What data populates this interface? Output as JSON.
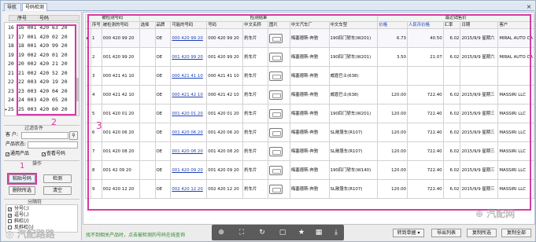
{
  "tabs": [
    {
      "label": "导航"
    },
    {
      "label": "号码检测"
    }
  ],
  "left_panel": {
    "list_headers": {
      "seq": "序号",
      "code": "号码"
    },
    "rows": [
      {
        "n": "16",
        "code": "16 001 420 63 20"
      },
      {
        "n": "17",
        "code": "17 001 420 02 20"
      },
      {
        "n": "18",
        "code": "18 001 420 99 20"
      },
      {
        "n": "19",
        "code": "19 002 420 01 20"
      },
      {
        "n": "20",
        "code": "20 002 420 21 20"
      },
      {
        "n": "21",
        "code": "21 002 420 52 20"
      },
      {
        "n": "22",
        "code": "22 003 420 19 20"
      },
      {
        "n": "23",
        "code": "23 003 420 04 20"
      },
      {
        "n": "24",
        "code": "24 003 420 05 20"
      },
      {
        "n": "25",
        "code": "25 003 420 60 20"
      }
    ],
    "current_marker": "▸",
    "annotation_2": "2",
    "filter_title": "过滤条件",
    "filter_label_1": "客 户:",
    "filter_label_2": "产品状态:",
    "check_general": "通用产品",
    "check_query": "查看号码",
    "ops_title": "操作",
    "annotation_1": "1",
    "btn_paste": "粘贴号码",
    "btn_detect": "检测",
    "btn_delete": "删除所选",
    "btn_clear": "清空",
    "cat_title": "分隔符",
    "cats": [
      {
        "checked": true,
        "label": "分号(;)"
      },
      {
        "checked": true,
        "label": "逗号(,)"
      },
      {
        "checked": false,
        "label": "斜杠(/)"
      },
      {
        "checked": false,
        "label": "反斜杠(\\)"
      }
    ]
  },
  "table": {
    "group_headers": {
      "detect": "被检测号码",
      "result": "检测结果",
      "recent": "最近销售价"
    },
    "columns": [
      "序号",
      "被检测的号码",
      "选择",
      "品牌",
      "可能的号码",
      "号码",
      "中文名称",
      "图片",
      "中文汽车厂",
      "中文车型",
      "价格",
      "人民币价格",
      "汇率",
      "日期",
      "客户"
    ],
    "annotation_3": "3",
    "rows": [
      {
        "arrow": "▸",
        "seq": "1",
        "code": "000 420 99 20",
        "brand": "OE",
        "possible": "000 420 99 20",
        "number": "000 420 99 20",
        "name": "刹车片",
        "maker": "梅塞德斯-奔驰",
        "model": "190四门轿车(W201)",
        "price": "6.73",
        "rmb": "40.50",
        "rate": "6.02",
        "date": "2015/9/9 星期六",
        "customer": "MIRAL AUTO CA",
        "has_img": true
      },
      {
        "arrow": "",
        "seq": "2",
        "code": "001 420 99 20",
        "brand": "OE",
        "possible": "001 420 99 20",
        "number": "001 420 99 20",
        "name": "刹车片",
        "maker": "梅塞德斯-奔驰",
        "model": "190四门轿车(W201)",
        "price": "3.50",
        "rmb": "21.07",
        "rate": "6.02",
        "date": "2015/9/9 星期六",
        "customer": "MIRAL AUTO CA",
        "has_img": true
      },
      {
        "arrow": "",
        "seq": "3",
        "code": "000 421 41 10",
        "brand": "OE",
        "possible": "000 421 41 10",
        "number": "000 421 41 10",
        "name": "刹车片",
        "maker": "梅塞德斯-奔驰",
        "model": "威霆巴士(638)",
        "price": "",
        "rmb": "",
        "rate": "",
        "date": "",
        "customer": "",
        "has_img": true
      },
      {
        "arrow": "",
        "seq": "4",
        "code": "000 421 42 10",
        "brand": "OE",
        "possible": "000 421 42 10",
        "number": "000 421 42 10",
        "name": "刹车片",
        "maker": "梅塞德斯-奔驰",
        "model": "威霆巴士(638)",
        "price": "120.00",
        "rmb": "722.40",
        "rate": "6.02",
        "date": "2015/9/9 星期三",
        "customer": "MASSIRI LLC",
        "has_img": true
      },
      {
        "arrow": "",
        "seq": "5",
        "code": "001 420 01 20",
        "brand": "OE",
        "possible": "001 420 01 20",
        "number": "001 420 01 20",
        "name": "刹车片",
        "maker": "梅塞德斯-奔驰",
        "model": "190四门轿车(W201)",
        "price": "120.00",
        "rmb": "722.40",
        "rate": "6.02",
        "date": "2015/9/9 星期三",
        "customer": "MASSIRI LLC",
        "has_img": true
      },
      {
        "arrow": "",
        "seq": "6",
        "code": "001 420 06 20",
        "brand": "OE",
        "possible": "001 420 06 20",
        "number": "001 420 06 20",
        "name": "刹车片",
        "maker": "梅塞德斯-奔驰",
        "model": "SL敞篷车(R107)",
        "price": "120.00",
        "rmb": "722.40",
        "rate": "6.02",
        "date": "2015/9/9 星期三",
        "customer": "MASSIRI LLC",
        "has_img": true
      },
      {
        "arrow": "",
        "seq": "7",
        "code": "001 420 08 20",
        "brand": "OE",
        "possible": "001 420 08 20",
        "number": "001 420 08 20",
        "name": "刹车片",
        "maker": "梅塞德斯-奔驰",
        "model": "SL敞篷车(R107)",
        "price": "120.00",
        "rmb": "722.40",
        "rate": "6.02",
        "date": "2015/9/9 星期三",
        "customer": "MASSIRI LLC",
        "has_img": true
      },
      {
        "arrow": "",
        "seq": "8",
        "code": "001 42 09 20",
        "brand": "OE",
        "possible": "001 420 09 20",
        "number": "001 420 09 20",
        "name": "刹车片",
        "maker": "梅塞德斯-奔驰",
        "model": "190四门轿车(W140)",
        "price": "120.00",
        "rmb": "722.40",
        "rate": "6.02",
        "date": "2015/9/9 星期三",
        "customer": "MASSIRI LLC",
        "has_img": true
      },
      {
        "arrow": "",
        "seq": "9",
        "code": "002 420 12 20",
        "brand": "OE",
        "possible": "002 420 12 20",
        "number": "002 420 12 20",
        "name": "刹车片",
        "maker": "梅塞德斯-奔驰",
        "model": "SL敞篷车(R107)",
        "price": "120.00",
        "rmb": "722.40",
        "rate": "6.02",
        "date": "2015/9/9 星期三",
        "customer": "MASSIRI LLC",
        "has_img": true
      }
    ]
  },
  "bottom": {
    "status": "找不到相关产品时，点击被检测的号码在线查询",
    "btn_convert": "转到单据",
    "btn_export": "导出列表",
    "btn_copy_sel": "复制所选",
    "btn_copy_all": "复制全部"
  },
  "watermarks": {
    "left": "汽配路路",
    "right": "汽配网"
  },
  "colors": {
    "annotation": "#d63aa3",
    "link": "#1a3fb8",
    "status": "#2b8a2b"
  }
}
